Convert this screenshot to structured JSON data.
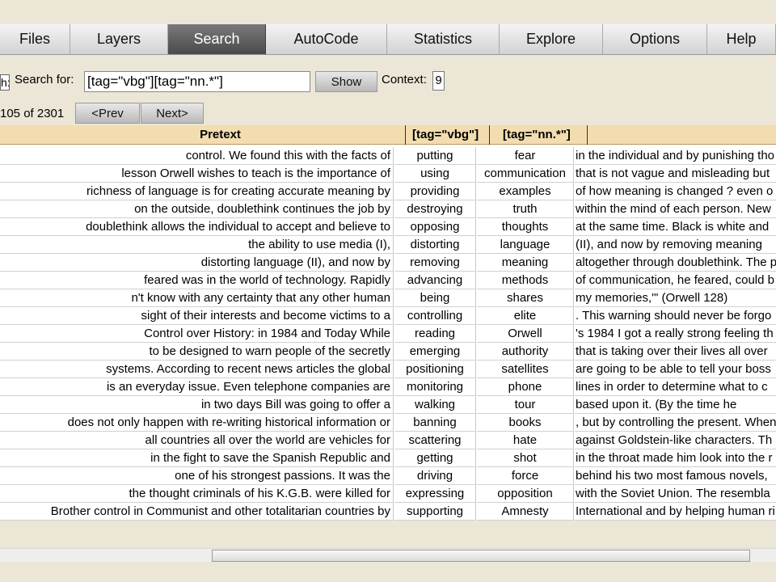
{
  "tabs": [
    {
      "label": "Files"
    },
    {
      "label": "Layers"
    },
    {
      "label": "Search"
    },
    {
      "label": "AutoCode"
    },
    {
      "label": "Statistics"
    },
    {
      "label": "Explore"
    },
    {
      "label": "Options"
    },
    {
      "label": "Help"
    }
  ],
  "search": {
    "cut_label": "h:",
    "search_for_label": "Search for:",
    "query": "[tag=\"vbg\"][tag=\"nn.*\"]",
    "show_label": "Show",
    "context_label": "Context:",
    "context_value": "9"
  },
  "pager": {
    "range_text": "105 of 2301",
    "prev_label": "<Prev",
    "next_label": "Next>"
  },
  "table": {
    "headers": [
      "Pretext",
      "[tag=\"vbg\"]",
      "[tag=\"nn.*\"]"
    ],
    "rows": [
      {
        "pre": "control. We found this with the facts of",
        "vbg": "putting",
        "nn": "fear",
        "post": "in the individual and by punishing tho"
      },
      {
        "pre": "lesson Orwell wishes to teach is the importance of",
        "vbg": "using",
        "nn": "communication",
        "post": "that is not vague and misleading but"
      },
      {
        "pre": "richness of language is for creating accurate meaning by",
        "vbg": "providing",
        "nn": "examples",
        "post": "of how meaning is changed ? even o"
      },
      {
        "pre": "on the outside, doublethink continues the job by",
        "vbg": "destroying",
        "nn": "truth",
        "post": "within the mind of each person. New"
      },
      {
        "pre": "doublethink allows the individual to accept and believe to",
        "vbg": "opposing",
        "nn": "thoughts",
        "post": "at the same time. Black is white and"
      },
      {
        "pre": "the ability to use media (I),",
        "vbg": "distorting",
        "nn": "language",
        "post": "(II), and now by removing meaning"
      },
      {
        "pre": "distorting language (II), and now by",
        "vbg": "removing",
        "nn": "meaning",
        "post": "altogether through doublethink. The p"
      },
      {
        "pre": "feared was in the world of technology. Rapidly",
        "vbg": "advancing",
        "nn": "methods",
        "post": "of communication, he feared, could b"
      },
      {
        "pre": "n't know with any certainty that any other human",
        "vbg": "being",
        "nn": "shares",
        "post": "my memories,'\" (Orwell 128)"
      },
      {
        "pre": "sight of their interests and become victims to a",
        "vbg": "controlling",
        "nn": "elite",
        "post": ". This warning should never be forgo"
      },
      {
        "pre": "Control over History: in 1984 and Today While",
        "vbg": "reading",
        "nn": "Orwell",
        "post": "'s 1984 I got a really strong feeling th"
      },
      {
        "pre": "to be designed to warn people of the secretly",
        "vbg": "emerging",
        "nn": "authority",
        "post": "that is taking over their lives all over"
      },
      {
        "pre": "systems. According to recent news articles the global",
        "vbg": "positioning",
        "nn": "satellites",
        "post": "are going to be able to tell your boss"
      },
      {
        "pre": "is an everyday issue. Even telephone companies are",
        "vbg": "monitoring",
        "nn": "phone",
        "post": "lines in order to determine what to c"
      },
      {
        "pre": "in two days Bill was going to offer a",
        "vbg": "walking",
        "nn": "tour",
        "post": "based upon it. (By the time he"
      },
      {
        "pre": "does not only happen with re-writing historical information or",
        "vbg": "banning",
        "nn": "books",
        "post": ", but by controlling the present. When"
      },
      {
        "pre": "all countries all over the world are vehicles for",
        "vbg": "scattering",
        "nn": "hate",
        "post": "against Goldstein-like characters. Th"
      },
      {
        "pre": "in the fight to save the Spanish Republic and",
        "vbg": "getting",
        "nn": "shot",
        "post": "in the throat made him look into the r"
      },
      {
        "pre": "one of his strongest passions. It was the",
        "vbg": "driving",
        "nn": "force",
        "post": "behind his two most famous novels,"
      },
      {
        "pre": "the thought criminals of his K.G.B. were killed for",
        "vbg": "expressing",
        "nn": "opposition",
        "post": "with the Soviet Union. The resembla"
      },
      {
        "pre": "Brother control in Communist and other totalitarian countries by",
        "vbg": "supporting",
        "nn": "Amnesty",
        "post": "International and by helping human ri"
      }
    ]
  }
}
